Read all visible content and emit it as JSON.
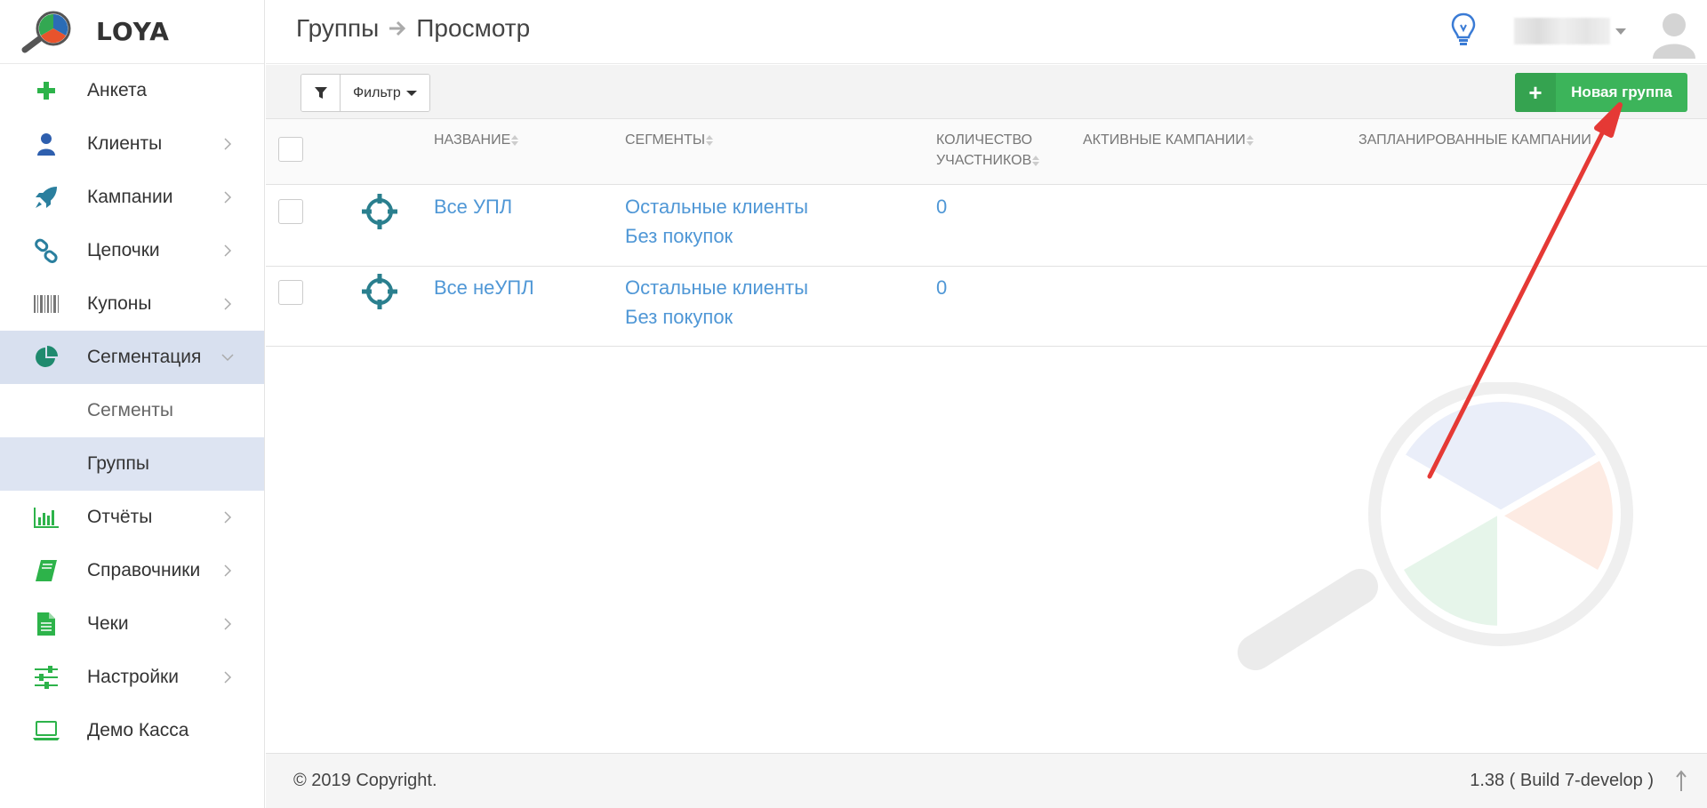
{
  "brand": {
    "name": "LOYA"
  },
  "sidebar": {
    "items": [
      {
        "label": "Анкета",
        "icon": "plus-icon",
        "color": "#2db34a"
      },
      {
        "label": "Клиенты",
        "icon": "user-icon",
        "color": "#2e5fae"
      },
      {
        "label": "Кампании",
        "icon": "rocket-icon",
        "color": "#2a7f9e"
      },
      {
        "label": "Цепочки",
        "icon": "link-icon",
        "color": "#2a7f9e"
      },
      {
        "label": "Купоны",
        "icon": "barcode-icon",
        "color": "#777777"
      },
      {
        "label": "Сегментация",
        "icon": "pie-chart-icon",
        "color": "#1f8a6e"
      },
      {
        "label": "Сегменты"
      },
      {
        "label": "Группы"
      },
      {
        "label": "Отчёты",
        "icon": "bar-chart-icon",
        "color": "#2db34a"
      },
      {
        "label": "Справочники",
        "icon": "book-icon",
        "color": "#2db34a"
      },
      {
        "label": "Чеки",
        "icon": "document-icon",
        "color": "#2db34a"
      },
      {
        "label": "Настройки",
        "icon": "sliders-icon",
        "color": "#2db34a"
      },
      {
        "label": "Демо Касса",
        "icon": "laptop-icon",
        "color": "#2db34a"
      }
    ]
  },
  "header": {
    "breadcrumb": [
      "Группы",
      "Просмотр"
    ]
  },
  "toolbar": {
    "filter_label": "Фильтр",
    "new_group_label": "Новая группа"
  },
  "table": {
    "columns": [
      "НАЗВАНИЕ",
      "СЕГМЕНТЫ",
      "КОЛИЧЕСТВО",
      "УЧАСТНИКОВ",
      "АКТИВНЫЕ КАМПАНИИ",
      "ЗАПЛАНИРОВАННЫЕ КАМПАНИИ"
    ],
    "rows": [
      {
        "name": "Все УПЛ",
        "segments": [
          "Остальные клиенты",
          "Без покупок"
        ],
        "count": "0"
      },
      {
        "name": "Все неУПЛ",
        "segments": [
          "Остальные клиенты",
          "Без покупок"
        ],
        "count": "0"
      }
    ]
  },
  "footer": {
    "copyright": "© 2019 Copyright.",
    "version": "1.38 ( Build 7-develop )"
  },
  "colors": {
    "accent_green": "#3cb45a",
    "link_blue": "#4f97d6",
    "active_bg": "#d8e0ef",
    "annotation_red": "#e53935"
  }
}
